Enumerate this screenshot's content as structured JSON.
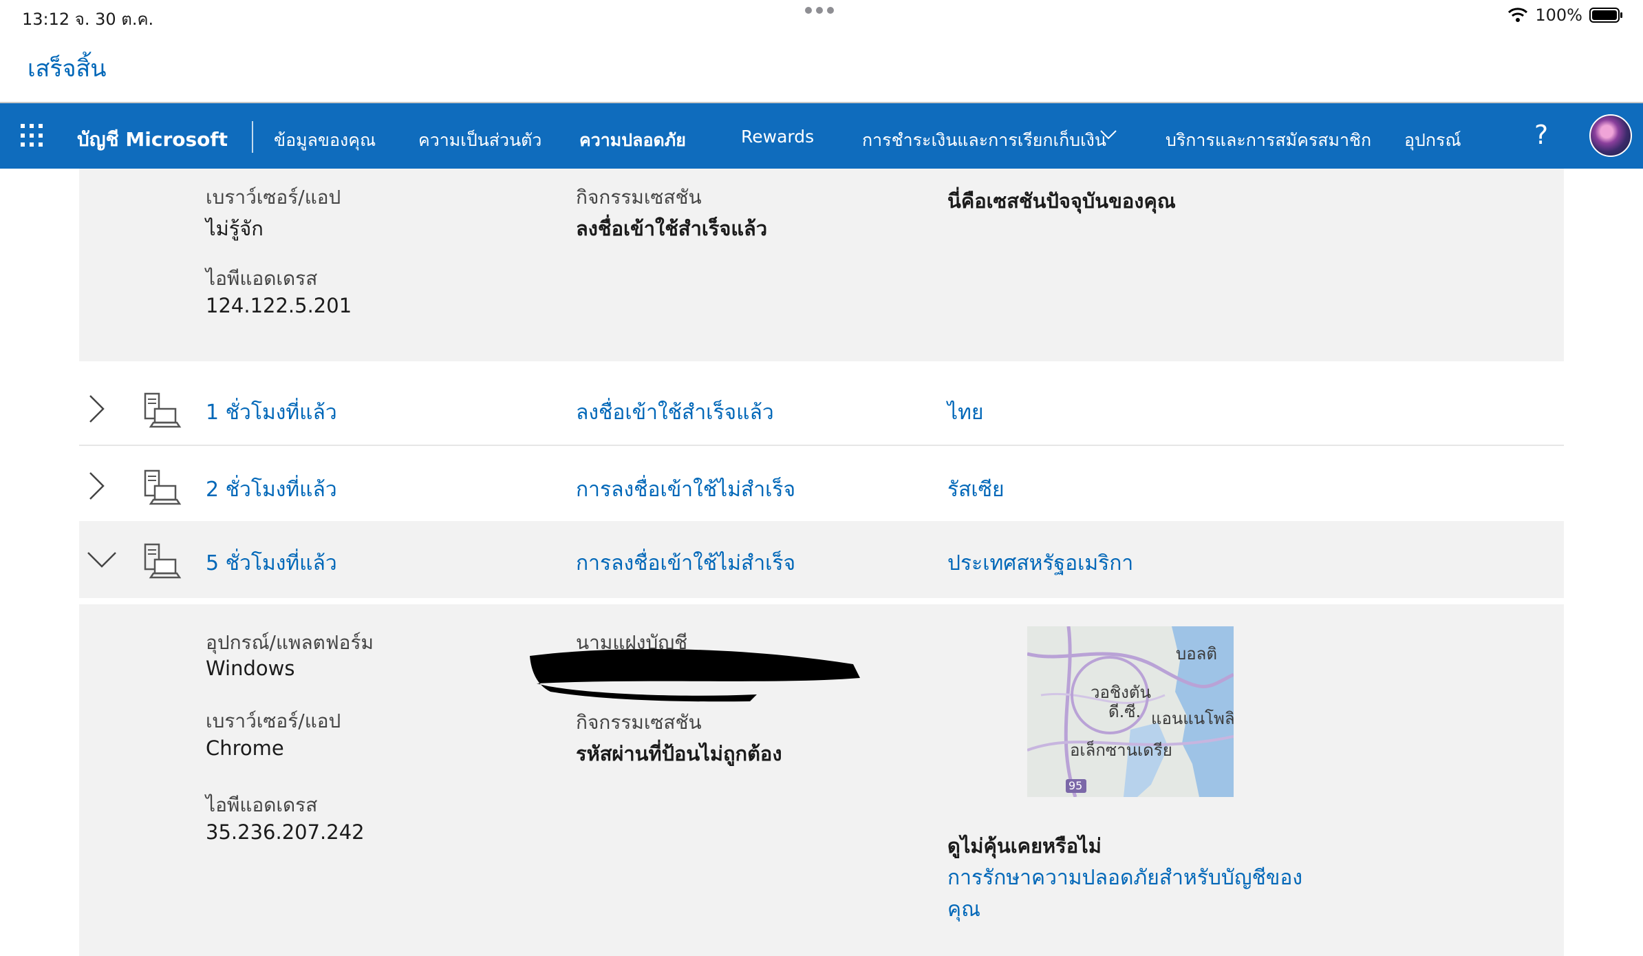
{
  "status": {
    "time": "13:12  จ. 30 ต.ค.",
    "battery": "100%"
  },
  "done_label": "เสร็จสิ้น",
  "nav": {
    "brand": "บัญชี Microsoft",
    "items": [
      "ข้อมูลของคุณ",
      "ความเป็นส่วนตัว",
      "ความปลอดภัย",
      "Rewards",
      "การชำระเงินและการเรียกเก็บเงิน",
      "บริการและการสมัครสมาชิก",
      "อุปกรณ์"
    ],
    "active_index": 2,
    "help": "?"
  },
  "current_session": {
    "browser_label": "เบราว์เซอร์/แอป",
    "browser_value": "ไม่รู้จัก",
    "activity_label": "กิจกรรมเซสชัน",
    "activity_value": "ลงชื่อเข้าใช้สำเร็จแล้ว",
    "note": "นี่คือเซสชันปัจจุบันของคุณ",
    "ip_label": "ไอพีแอดเดรส",
    "ip_value": "124.122.5.201"
  },
  "rows": [
    {
      "time": "1 ชั่วโมงที่แล้ว",
      "status": "ลงชื่อเข้าใช้สำเร็จแล้ว",
      "country": "ไทย"
    },
    {
      "time": "2 ชั่วโมงที่แล้ว",
      "status": "การลงชื่อเข้าใช้ไม่สำเร็จ",
      "country": "รัสเซีย"
    },
    {
      "time": "5 ชั่วโมงที่แล้ว",
      "status": "การลงชื่อเข้าใช้ไม่สำเร็จ",
      "country": "ประเทศสหรัฐอเมริกา"
    }
  ],
  "expanded": {
    "device_label": "อุปกรณ์/แพลตฟอร์ม",
    "device_value": "Windows",
    "alias_label": "นามแฝงบัญชี",
    "browser_label": "เบราว์เซอร์/แอป",
    "browser_value": "Chrome",
    "activity_label": "กิจกรรมเซสชัน",
    "activity_value": "รหัสผ่านที่ป้อนไม่ถูกต้อง",
    "ip_label": "ไอพีแอดเดรส",
    "ip_value": "35.236.207.242",
    "map_labels": [
      "บอลติ",
      "วอชิงตัน",
      "ดี.ซี.",
      "แอนแนโพลิ",
      "อเล็กซานเดรีย",
      "95"
    ],
    "unfamiliar_label": "ดูไม่คุ้นเคยหรือไม่",
    "secure_link_line1": "การรักษาความปลอดภัยสำหรับบัญชีของ",
    "secure_link_line2": "คุณ"
  },
  "colors": {
    "accent": "#0f6cbd",
    "link": "#0067b8",
    "panel": "#f2f2f2"
  }
}
